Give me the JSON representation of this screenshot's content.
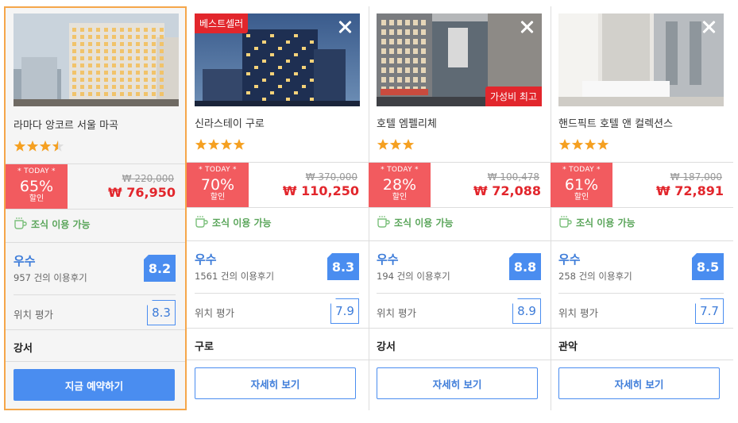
{
  "colors": {
    "selected_border": "#f5a64a",
    "deal_red": "#f25b5f",
    "price_red": "#e2262c",
    "accent_blue": "#4a8df0",
    "breakfast_green": "#5aa55a",
    "star_orange": "#f5a021"
  },
  "hotels": [
    {
      "name": "라마다 앙코르 서울 마곡",
      "stars": 3.5,
      "badge_top": "",
      "badge_bottom": "",
      "show_close": false,
      "deal_label": "* TODAY *",
      "discount": "65%",
      "discount_label": "할인",
      "original_price": "₩ 220,000",
      "sale_price": "₩ 76,950",
      "breakfast": "조식 이용 가능",
      "grade": "우수",
      "review_count": "957 건의 이용후기",
      "score": "8.2",
      "location_label": "위치 평가",
      "location_score": "8.3",
      "district": "강서",
      "cta": "지금 예약하기",
      "cta_style": "primary",
      "selected": true
    },
    {
      "name": "신라스테이 구로",
      "stars": 4,
      "badge_top": "베스트셀러",
      "badge_bottom": "",
      "show_close": true,
      "deal_label": "* TODAY *",
      "discount": "70%",
      "discount_label": "할인",
      "original_price": "₩ 370,000",
      "sale_price": "₩ 110,250",
      "breakfast": "조식 이용 가능",
      "grade": "우수",
      "review_count": "1561 건의 이용후기",
      "score": "8.3",
      "location_label": "위치 평가",
      "location_score": "7.9",
      "district": "구로",
      "cta": "자세히 보기",
      "cta_style": "secondary",
      "selected": false
    },
    {
      "name": "호텔 엠펠리체",
      "stars": 3,
      "badge_top": "",
      "badge_bottom": "가성비 최고",
      "show_close": true,
      "deal_label": "* TODAY *",
      "discount": "28%",
      "discount_label": "할인",
      "original_price": "₩ 100,478",
      "sale_price": "₩ 72,088",
      "breakfast": "조식 이용 가능",
      "grade": "우수",
      "review_count": "194 건의 이용후기",
      "score": "8.8",
      "location_label": "위치 평가",
      "location_score": "8.9",
      "district": "강서",
      "cta": "자세히 보기",
      "cta_style": "secondary",
      "selected": false
    },
    {
      "name": "핸드픽트 호텔 앤 컬렉션스",
      "stars": 4,
      "badge_top": "",
      "badge_bottom": "",
      "show_close": true,
      "deal_label": "* TODAY *",
      "discount": "61%",
      "discount_label": "할인",
      "original_price": "₩ 187,000",
      "sale_price": "₩ 72,891",
      "breakfast": "조식 이용 가능",
      "grade": "우수",
      "review_count": "258 건의 이용후기",
      "score": "8.5",
      "location_label": "위치 평가",
      "location_score": "7.7",
      "district": "관악",
      "cta": "자세히 보기",
      "cta_style": "secondary",
      "selected": false
    }
  ]
}
